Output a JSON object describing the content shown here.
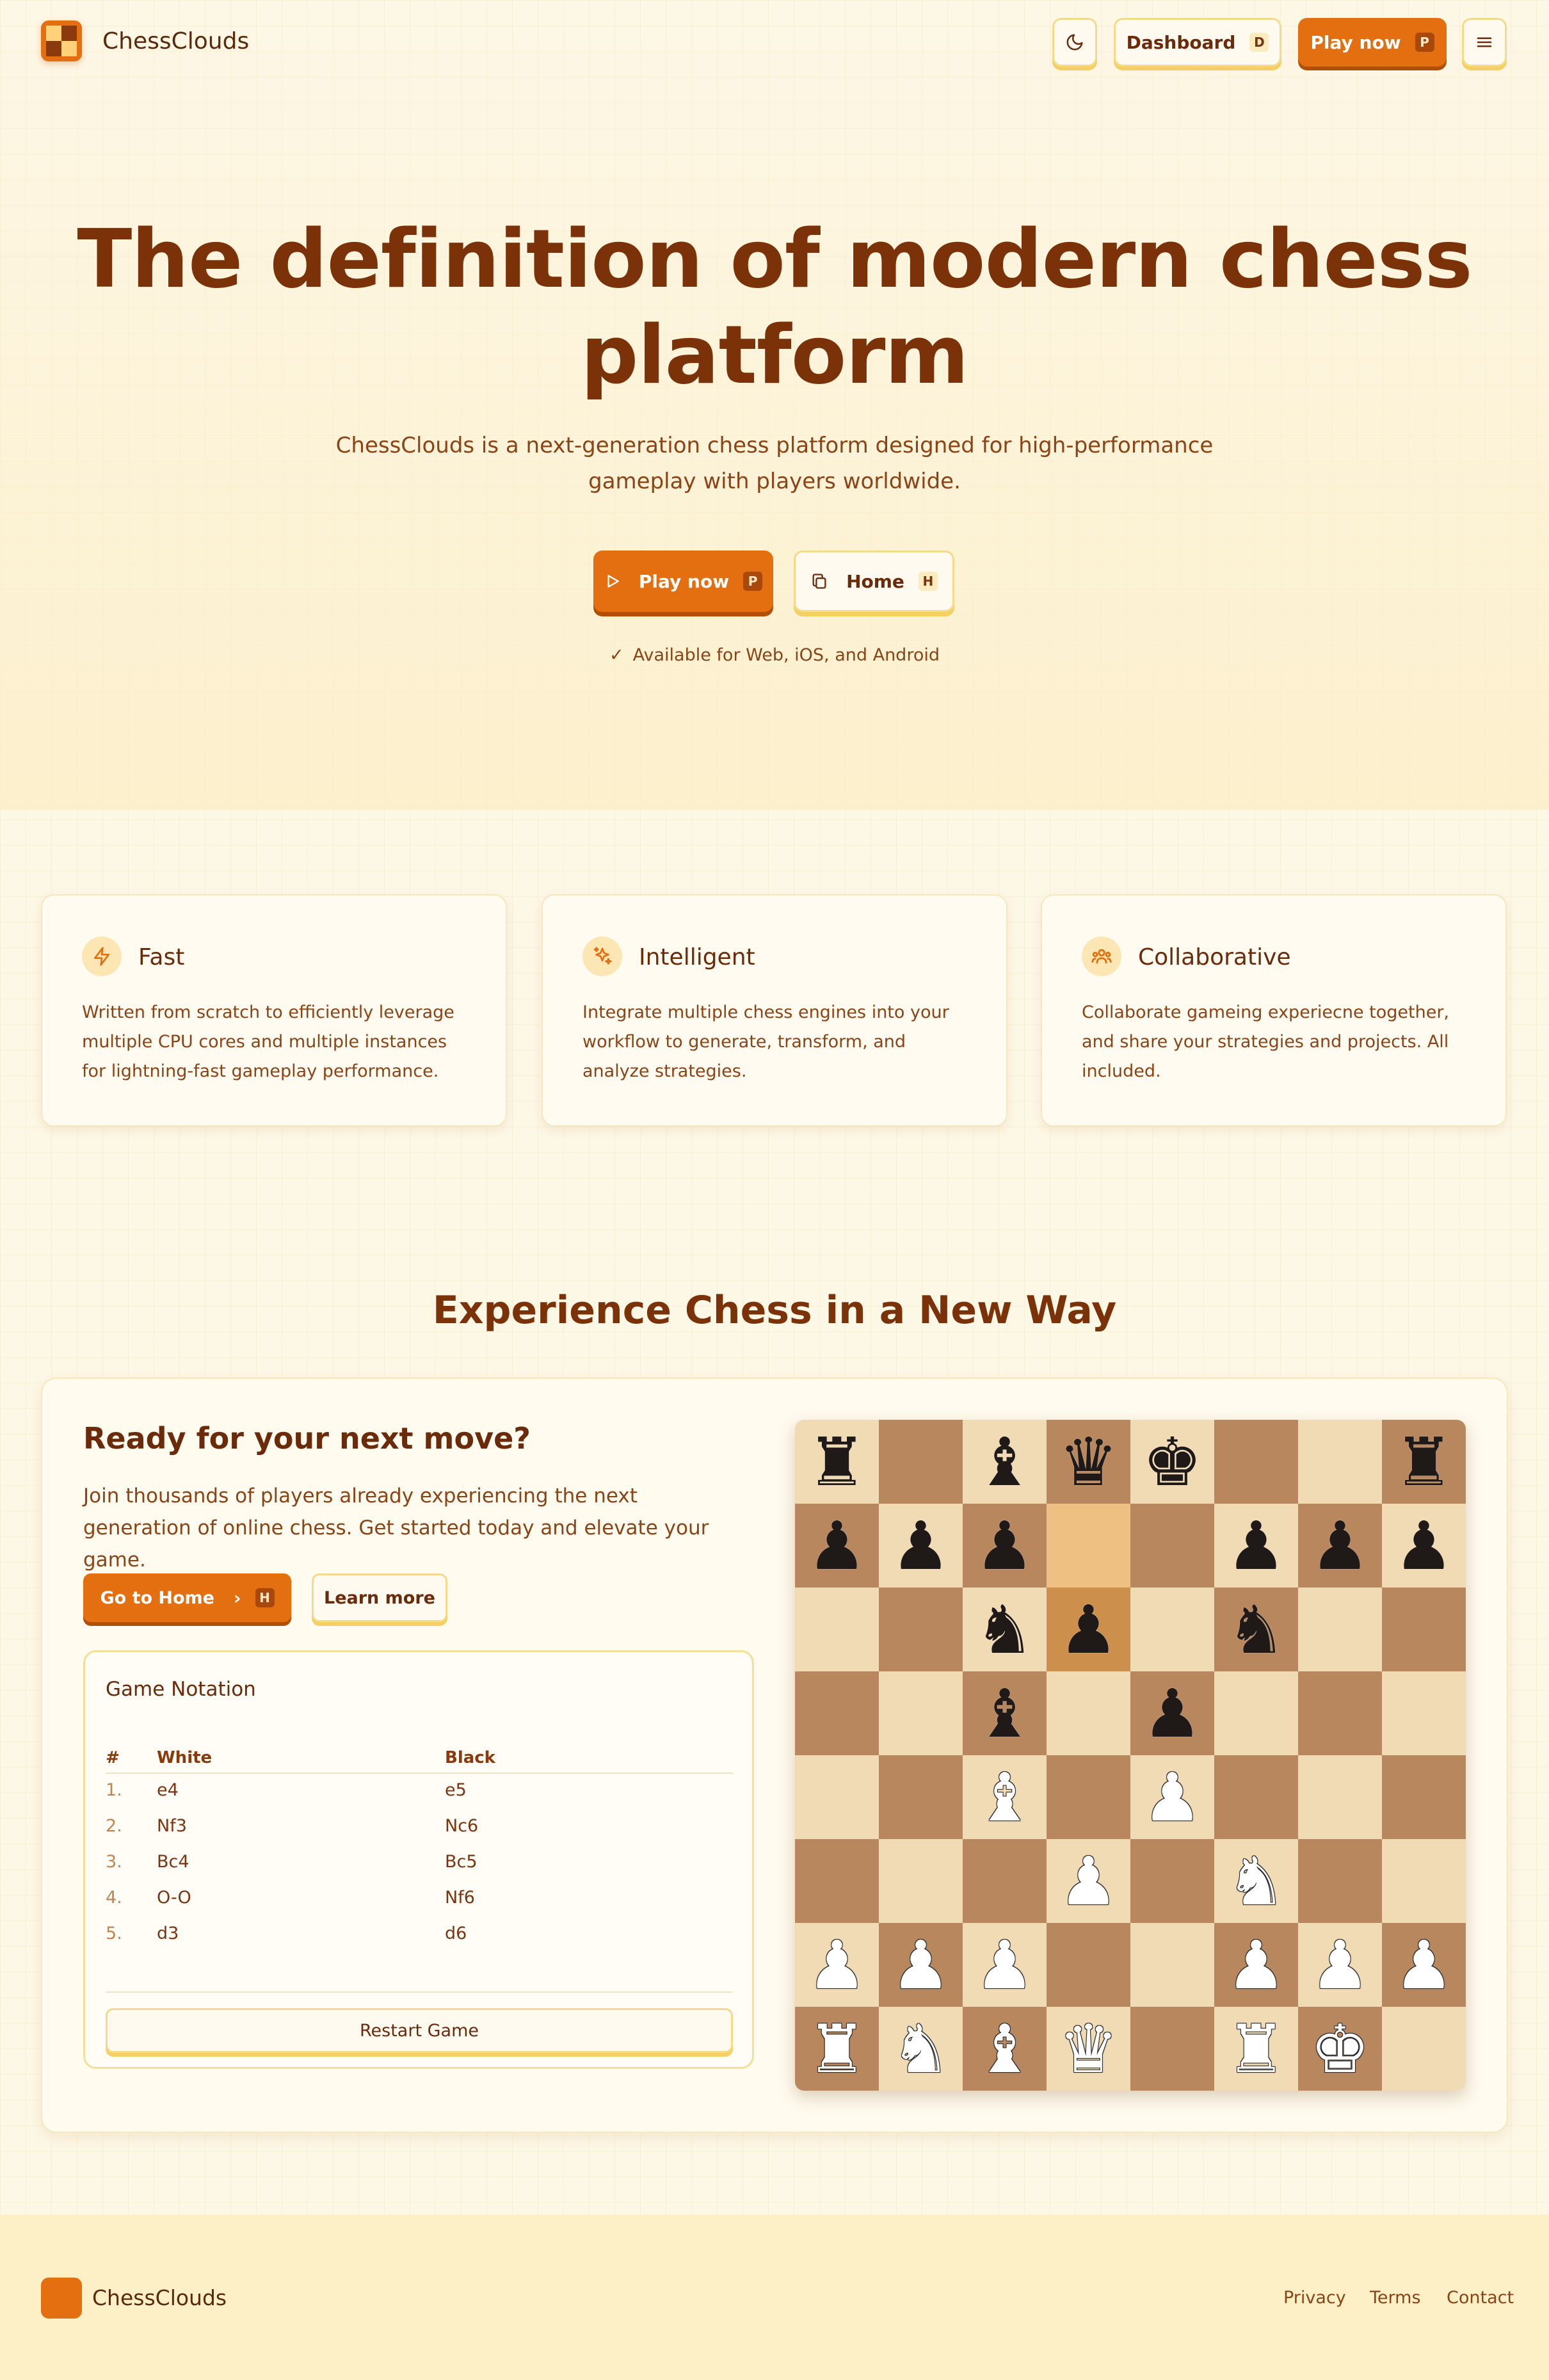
{
  "header": {
    "brand": "ChessClouds",
    "theme_toggle_icon": "moon-icon",
    "dashboard_label": "Dashboard",
    "dashboard_key": "D",
    "play_label": "Play now",
    "play_key": "P",
    "menu_icon": "menu-icon"
  },
  "hero": {
    "title_line1": "The definition of modern chess",
    "title_line2": "platform",
    "subtitle": "ChessClouds is a next-generation chess platform designed for high-performance gameplay with players worldwide.",
    "play_label": "Play now",
    "play_key": "P",
    "home_label": "Home",
    "home_key": "H",
    "availability": "Available for Web, iOS, and Android"
  },
  "features": [
    {
      "icon": "lightning-icon",
      "title": "Fast",
      "desc": "Written from scratch to efficiently leverage multiple CPU cores and multiple instances for lightning-fast gameplay performance."
    },
    {
      "icon": "sparkles-icon",
      "title": "Intelligent",
      "desc": "Integrate multiple chess engines into your workflow to generate, transform, and analyze strategies."
    },
    {
      "icon": "users-icon",
      "title": "Collaborative",
      "desc": "Collaborate gameing experiecne together, and share your strategies and projects. All included."
    }
  ],
  "experience": {
    "section_title": "Experience Chess in a New Way",
    "panel_title": "Ready for your next move?",
    "panel_desc": "Join thousands of players already experiencing the next generation of online chess. Get started today and elevate your game.",
    "go_home_label": "Go to Home",
    "go_home_key": "H",
    "learn_more_label": "Learn more"
  },
  "notation": {
    "title": "Game Notation",
    "headers": [
      "#",
      "White",
      "Black"
    ],
    "moves": [
      {
        "n": "1.",
        "white": "e4",
        "black": "e5"
      },
      {
        "n": "2.",
        "white": "Nf3",
        "black": "Nc6"
      },
      {
        "n": "3.",
        "white": "Bc4",
        "black": "Bc5"
      },
      {
        "n": "4.",
        "white": "O-O",
        "black": "Nf6"
      },
      {
        "n": "5.",
        "white": "d3",
        "black": "d6"
      }
    ],
    "restart_label": "Restart Game"
  },
  "board": {
    "highlight_squares": [
      "d7",
      "d6"
    ],
    "ranks": [
      [
        "r",
        "",
        "b",
        "q",
        "k",
        "",
        "",
        "r"
      ],
      [
        "p",
        "p",
        "p",
        "",
        "",
        "p",
        "p",
        "p"
      ],
      [
        "",
        "",
        "n",
        "p",
        "",
        "n",
        "",
        ""
      ],
      [
        "",
        "",
        "b",
        "",
        "p",
        "",
        "",
        ""
      ],
      [
        "",
        "",
        "B",
        "",
        "P",
        "",
        "",
        ""
      ],
      [
        "",
        "",
        "",
        "P",
        "",
        "N",
        "",
        ""
      ],
      [
        "P",
        "P",
        "P",
        "",
        "",
        "P",
        "P",
        "P"
      ],
      [
        "R",
        "N",
        "B",
        "Q",
        "",
        "R",
        "K",
        ""
      ]
    ]
  },
  "footer": {
    "brand": "ChessClouds",
    "links": [
      "Privacy",
      "Terms",
      "Contact"
    ]
  },
  "colors": {
    "accent": "#e36f10",
    "title": "#7b3209",
    "background": "#fdf7e6",
    "board_light": "#f0dbb5",
    "board_dark": "#b8875e"
  }
}
